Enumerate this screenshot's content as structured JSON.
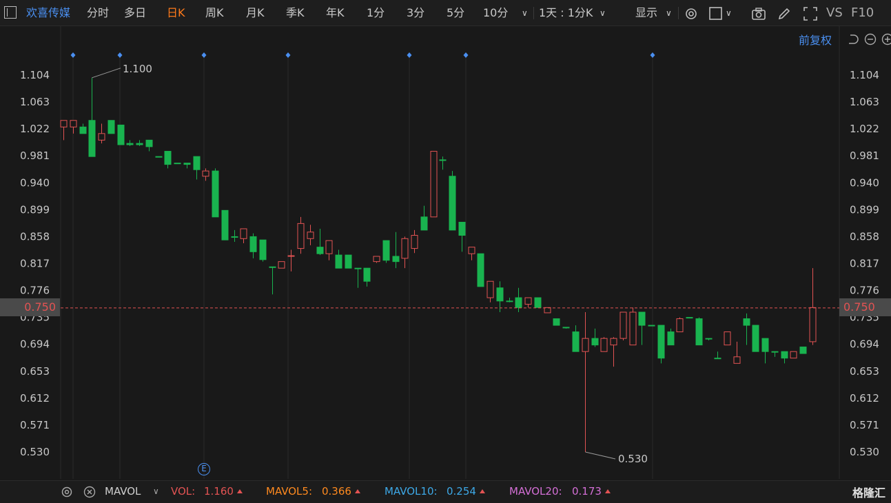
{
  "toolbar": {
    "stock_name": "欢喜传媒",
    "tabs": [
      "分时",
      "多日",
      "日K",
      "周K",
      "月K",
      "季K",
      "年K",
      "1分",
      "3分",
      "5分",
      "10分"
    ],
    "active_tab": "日K",
    "period_select": "1天 : 1分K",
    "display_label": "显示",
    "vs_label": "VS",
    "f10_label": "F10"
  },
  "adjust_label": "前复权",
  "current_price": "0.750",
  "event_badge": "E",
  "bottom": {
    "indicator_name": "MAVOL",
    "vol_label": "VOL:",
    "vol_value": "1.160",
    "mavol5_label": "MAVOL5:",
    "mavol5_value": "0.366",
    "mavol10_label": "MAVOL10:",
    "mavol10_value": "0.254",
    "mavol20_label": "MAVOL20:",
    "mavol20_value": "0.173",
    "logo_text": "格隆汇"
  },
  "colors": {
    "up": "#e35353",
    "down": "#19b34f",
    "accent": "#ff7a1a",
    "link": "#4a8ff0",
    "mavol5": "#ff8a1f",
    "mavol10": "#3da9e8",
    "mavol20": "#d46fd6",
    "vol": "#e35353"
  },
  "chart_data": {
    "type": "candlestick",
    "y_ticks": [
      "1.104",
      "1.063",
      "1.022",
      "0.981",
      "0.940",
      "0.899",
      "0.858",
      "0.817",
      "0.776",
      "0.735",
      "0.694",
      "0.653",
      "0.612",
      "0.571",
      "0.530"
    ],
    "ylim": [
      0.514,
      1.13
    ],
    "max_label": "1.100",
    "min_label": "0.530",
    "current_price": 0.75,
    "grid": true,
    "event_markers_count": 7,
    "candles": [
      {
        "o": 1.025,
        "c": 1.035,
        "h": 1.035,
        "l": 1.005
      },
      {
        "o": 1.025,
        "c": 1.035,
        "h": 1.035,
        "l": 1.015
      },
      {
        "o": 1.025,
        "c": 1.015,
        "h": 1.03,
        "l": 1.015
      },
      {
        "o": 1.035,
        "c": 0.98,
        "h": 1.1,
        "l": 0.98
      },
      {
        "o": 1.005,
        "c": 1.015,
        "h": 1.03,
        "l": 1.0
      },
      {
        "o": 1.035,
        "c": 1.015,
        "h": 1.035,
        "l": 1.015
      },
      {
        "o": 1.028,
        "c": 0.998,
        "h": 1.028,
        "l": 0.998
      },
      {
        "o": 1.0,
        "c": 0.998,
        "h": 1.005,
        "l": 0.996
      },
      {
        "o": 1.0,
        "c": 0.998,
        "h": 1.005,
        "l": 0.996
      },
      {
        "o": 1.005,
        "c": 0.995,
        "h": 1.005,
        "l": 0.988
      },
      {
        "o": 0.98,
        "c": 0.979,
        "h": 0.98,
        "l": 0.979
      },
      {
        "o": 0.988,
        "c": 0.968,
        "h": 0.988,
        "l": 0.962
      },
      {
        "o": 0.97,
        "c": 0.969,
        "h": 0.97,
        "l": 0.969
      },
      {
        "o": 0.97,
        "c": 0.968,
        "h": 0.97,
        "l": 0.962
      },
      {
        "o": 0.98,
        "c": 0.96,
        "h": 0.98,
        "l": 0.945
      },
      {
        "o": 0.95,
        "c": 0.958,
        "h": 0.962,
        "l": 0.943
      },
      {
        "o": 0.958,
        "c": 0.888,
        "h": 0.962,
        "l": 0.888
      },
      {
        "o": 0.898,
        "c": 0.853,
        "h": 0.898,
        "l": 0.853
      },
      {
        "o": 0.858,
        "c": 0.857,
        "h": 0.868,
        "l": 0.85
      },
      {
        "o": 0.855,
        "c": 0.87,
        "h": 0.87,
        "l": 0.848
      },
      {
        "o": 0.858,
        "c": 0.835,
        "h": 0.863,
        "l": 0.825
      },
      {
        "o": 0.853,
        "c": 0.823,
        "h": 0.853,
        "l": 0.82
      },
      {
        "o": 0.812,
        "c": 0.811,
        "h": 0.812,
        "l": 0.77
      },
      {
        "o": 0.81,
        "c": 0.82,
        "h": 0.82,
        "l": 0.81
      },
      {
        "o": 0.828,
        "c": 0.829,
        "h": 0.838,
        "l": 0.805
      },
      {
        "o": 0.84,
        "c": 0.878,
        "h": 0.888,
        "l": 0.832
      },
      {
        "o": 0.855,
        "c": 0.865,
        "h": 0.876,
        "l": 0.845
      },
      {
        "o": 0.842,
        "c": 0.832,
        "h": 0.87,
        "l": 0.83
      },
      {
        "o": 0.832,
        "c": 0.852,
        "h": 0.852,
        "l": 0.822
      },
      {
        "o": 0.83,
        "c": 0.81,
        "h": 0.838,
        "l": 0.81
      },
      {
        "o": 0.83,
        "c": 0.81,
        "h": 0.83,
        "l": 0.81
      },
      {
        "o": 0.81,
        "c": 0.809,
        "h": 0.81,
        "l": 0.78
      },
      {
        "o": 0.81,
        "c": 0.79,
        "h": 0.81,
        "l": 0.782
      },
      {
        "o": 0.82,
        "c": 0.828,
        "h": 0.828,
        "l": 0.818
      },
      {
        "o": 0.852,
        "c": 0.822,
        "h": 0.852,
        "l": 0.818
      },
      {
        "o": 0.828,
        "c": 0.82,
        "h": 0.865,
        "l": 0.81
      },
      {
        "o": 0.825,
        "c": 0.855,
        "h": 0.858,
        "l": 0.81
      },
      {
        "o": 0.84,
        "c": 0.86,
        "h": 0.868,
        "l": 0.833
      },
      {
        "o": 0.888,
        "c": 0.868,
        "h": 0.905,
        "l": 0.868
      },
      {
        "o": 0.888,
        "c": 0.988,
        "h": 0.988,
        "l": 0.888
      },
      {
        "o": 0.975,
        "c": 0.974,
        "h": 0.98,
        "l": 0.96
      },
      {
        "o": 0.95,
        "c": 0.868,
        "h": 0.958,
        "l": 0.868
      },
      {
        "o": 0.88,
        "c": 0.86,
        "h": 0.88,
        "l": 0.835
      },
      {
        "o": 0.832,
        "c": 0.842,
        "h": 0.842,
        "l": 0.822
      },
      {
        "o": 0.832,
        "c": 0.782,
        "h": 0.832,
        "l": 0.782
      },
      {
        "o": 0.765,
        "c": 0.79,
        "h": 0.79,
        "l": 0.758
      },
      {
        "o": 0.78,
        "c": 0.76,
        "h": 0.79,
        "l": 0.743
      },
      {
        "o": 0.76,
        "c": 0.759,
        "h": 0.765,
        "l": 0.758
      },
      {
        "o": 0.765,
        "c": 0.75,
        "h": 0.78,
        "l": 0.743
      },
      {
        "o": 0.755,
        "c": 0.765,
        "h": 0.765,
        "l": 0.75
      },
      {
        "o": 0.765,
        "c": 0.75,
        "h": 0.765,
        "l": 0.75
      },
      {
        "o": 0.742,
        "c": 0.75,
        "h": 0.75,
        "l": 0.742
      },
      {
        "o": 0.733,
        "c": 0.723,
        "h": 0.733,
        "l": 0.723
      },
      {
        "o": 0.72,
        "c": 0.719,
        "h": 0.72,
        "l": 0.718
      },
      {
        "o": 0.713,
        "c": 0.683,
        "h": 0.723,
        "l": 0.683
      },
      {
        "o": 0.683,
        "c": 0.703,
        "h": 0.743,
        "l": 0.53
      },
      {
        "o": 0.703,
        "c": 0.693,
        "h": 0.718,
        "l": 0.69
      },
      {
        "o": 0.683,
        "c": 0.703,
        "h": 0.705,
        "l": 0.683
      },
      {
        "o": 0.693,
        "c": 0.703,
        "h": 0.705,
        "l": 0.66
      },
      {
        "o": 0.703,
        "c": 0.743,
        "h": 0.743,
        "l": 0.7
      },
      {
        "o": 0.693,
        "c": 0.743,
        "h": 0.75,
        "l": 0.693
      },
      {
        "o": 0.743,
        "c": 0.723,
        "h": 0.743,
        "l": 0.693
      },
      {
        "o": 0.723,
        "c": 0.722,
        "h": 0.723,
        "l": 0.722
      },
      {
        "o": 0.723,
        "c": 0.673,
        "h": 0.723,
        "l": 0.665
      },
      {
        "o": 0.713,
        "c": 0.693,
        "h": 0.718,
        "l": 0.693
      },
      {
        "o": 0.713,
        "c": 0.733,
        "h": 0.735,
        "l": 0.713
      },
      {
        "o": 0.735,
        "c": 0.734,
        "h": 0.735,
        "l": 0.734
      },
      {
        "o": 0.733,
        "c": 0.693,
        "h": 0.735,
        "l": 0.693
      },
      {
        "o": 0.703,
        "c": 0.702,
        "h": 0.703,
        "l": 0.7
      },
      {
        "o": 0.673,
        "c": 0.672,
        "h": 0.683,
        "l": 0.672
      },
      {
        "o": 0.693,
        "c": 0.713,
        "h": 0.713,
        "l": 0.693
      },
      {
        "o": 0.665,
        "c": 0.675,
        "h": 0.698,
        "l": 0.665
      },
      {
        "o": 0.733,
        "c": 0.723,
        "h": 0.741,
        "l": 0.693
      },
      {
        "o": 0.723,
        "c": 0.683,
        "h": 0.723,
        "l": 0.683
      },
      {
        "o": 0.703,
        "c": 0.683,
        "h": 0.703,
        "l": 0.665
      },
      {
        "o": 0.683,
        "c": 0.682,
        "h": 0.683,
        "l": 0.675
      },
      {
        "o": 0.683,
        "c": 0.673,
        "h": 0.683,
        "l": 0.665
      },
      {
        "o": 0.673,
        "c": 0.683,
        "h": 0.683,
        "l": 0.673
      },
      {
        "o": 0.69,
        "c": 0.68,
        "h": 0.69,
        "l": 0.68
      },
      {
        "o": 0.698,
        "c": 0.75,
        "h": 0.81,
        "l": 0.693
      }
    ]
  }
}
